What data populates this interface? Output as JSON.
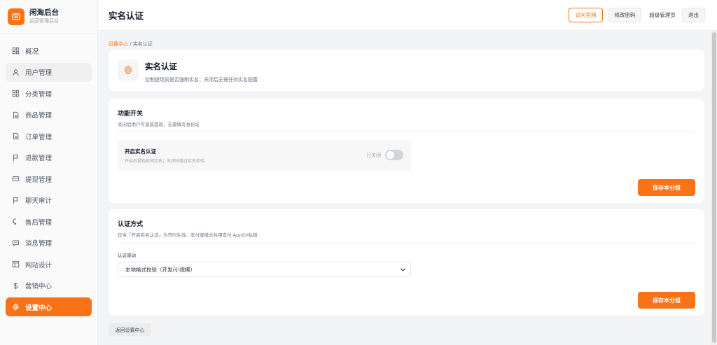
{
  "brand": {
    "title": "闲淘后台",
    "subtitle": "运营管理后台",
    "logo_icon": "store-icon",
    "accent": "#f97316"
  },
  "sidebar": {
    "items": [
      {
        "label": "概况",
        "icon": "grid-icon"
      },
      {
        "label": "用户管理",
        "icon": "user-icon"
      },
      {
        "label": "分类管理",
        "icon": "grid-icon"
      },
      {
        "label": "商品管理",
        "icon": "document-icon"
      },
      {
        "label": "订单管理",
        "icon": "document-icon"
      },
      {
        "label": "退款管理",
        "icon": "flag-icon"
      },
      {
        "label": "提现管理",
        "icon": "card-icon"
      },
      {
        "label": "聊天审计",
        "icon": "flag-icon"
      },
      {
        "label": "售后管理",
        "icon": "chat-icon"
      },
      {
        "label": "消息管理",
        "icon": "message-icon"
      },
      {
        "label": "网站设计",
        "icon": "layout-icon"
      },
      {
        "label": "营销中心",
        "icon": "dollar-icon"
      },
      {
        "label": "设置中心",
        "icon": "gear-icon"
      }
    ],
    "hovered_index": 1,
    "active_index": 12
  },
  "header": {
    "title": "实名认证",
    "visit_site": "访问官网",
    "change_password": "修改密码",
    "role": "超级管理员",
    "logout": "退出"
  },
  "breadcrumb": {
    "parent": "设置中心",
    "separator": " / ",
    "current": "实名认证"
  },
  "hero": {
    "title": "实名认证",
    "description": "控制提现前是否强制实名；关闭后无需任何实名配置",
    "icon": "gear-icon"
  },
  "function_section": {
    "title": "功能开关",
    "description": "关闭后用户可直接提现，无需填写身份证",
    "toggle": {
      "title": "开启实名认证",
      "description": "开启后提现前须实名；关闭时跳过实名检验",
      "state_label": "已关闭",
      "enabled": false
    },
    "save_label": "保存本分组"
  },
  "auth_section": {
    "title": "认证方式",
    "description": "仅当「开启实名认证」为开时生效。支付宝模式共用支付 AppID/私钥",
    "driver_label": "认证驱动",
    "driver_value": "本地格式校验（开发/小规模）",
    "save_label": "保存本分组"
  },
  "back_label": "返回设置中心"
}
